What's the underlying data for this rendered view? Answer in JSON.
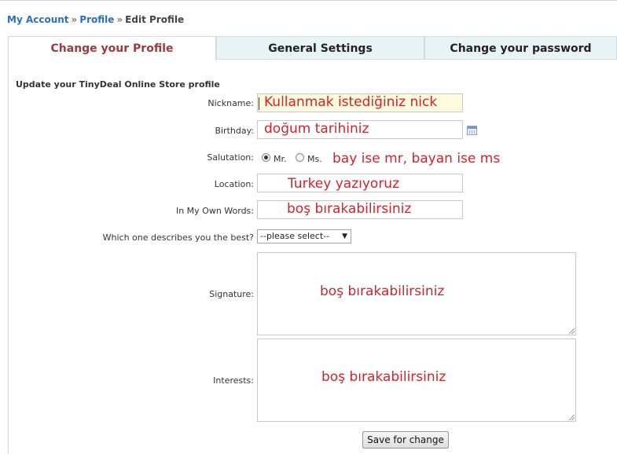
{
  "breadcrumb": {
    "items": [
      "My Account",
      "Profile",
      "Edit Profile"
    ],
    "separator": "»"
  },
  "tabs": [
    {
      "label": "Change your Profile",
      "active": true
    },
    {
      "label": "General Settings",
      "active": false
    },
    {
      "label": "Change your password",
      "active": false
    }
  ],
  "form": {
    "heading": "Update your TinyDeal Online Store profile",
    "nickname": {
      "label": "Nickname:",
      "annotation": "Kullanmak istediğiniz nick"
    },
    "birthday": {
      "label": "Birthday:",
      "annotation": "doğum tarihiniz"
    },
    "salutation": {
      "label": "Salutation:",
      "options": [
        "Mr.",
        "Ms."
      ],
      "selected": "Mr.",
      "annotation": "bay ise mr, bayan ise ms"
    },
    "location": {
      "label": "Location:",
      "annotation": "Turkey yazıyoruz"
    },
    "own_words": {
      "label": "In My Own Words:",
      "annotation": "boş bırakabilirsiniz"
    },
    "describes": {
      "label": "Which one describes you the best?",
      "selected": "--please select--"
    },
    "signature": {
      "label": "Signature:",
      "annotation": "boş bırakabilirsiniz"
    },
    "interests": {
      "label": "Interests:",
      "annotation": "boş bırakabilirsiniz"
    },
    "save_label": "Save for change"
  },
  "colors": {
    "link": "#2c6fb8",
    "active_tab": "#9b3b3b",
    "annotation": "#d0232c",
    "tab_bg": "#e8f3f6"
  }
}
